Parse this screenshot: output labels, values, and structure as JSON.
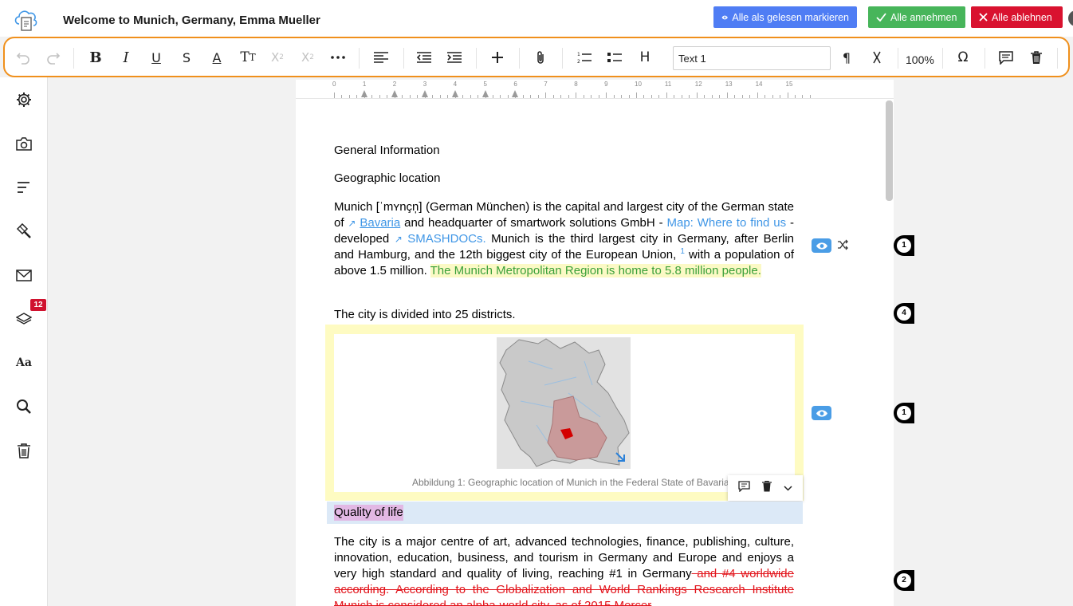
{
  "header": {
    "title": "Welcome to Munich, Germany, Emma Mueller",
    "mark_read_label": "Alle als gelesen markieren",
    "accept_all_label": "Alle annehmen",
    "reject_all_label": "Alle ablehnen",
    "colors": {
      "mark_read": "#4f7df4",
      "accept": "#47b55a",
      "reject": "#d9122f"
    }
  },
  "toolbar": {
    "paragraph_style": "Text 1",
    "zoom": "100%",
    "highlight_color": "#f0901c",
    "icons": [
      "undo-icon",
      "redo-icon",
      "bold-icon",
      "italic-icon",
      "underline-icon",
      "strikethrough-icon",
      "font-color-icon",
      "font-size-icon",
      "superscript-icon",
      "subscript-icon",
      "more-icon",
      "align-left-icon",
      "outdent-icon",
      "indent-icon",
      "insert-icon",
      "attachment-icon",
      "numbered-list-icon",
      "bullet-list-icon",
      "heading-icon",
      "pilcrow-icon",
      "clear-format-icon",
      "omega-icon",
      "comment-icon",
      "trash-icon"
    ]
  },
  "sidebar": {
    "icons": [
      "gear-icon",
      "camera-icon",
      "outline-icon",
      "paint-brush-icon",
      "mail-icon",
      "layers-icon",
      "typography-icon",
      "search-icon",
      "trash-icon"
    ],
    "layers_badge": "12",
    "typography_label": "Aa"
  },
  "ruler": {
    "numbers": [
      "0",
      "1",
      "2",
      "3",
      "4",
      "5",
      "6",
      "7",
      "8",
      "9",
      "10",
      "11",
      "12",
      "13",
      "14",
      "15"
    ]
  },
  "document": {
    "heading1": "General Information",
    "heading2": "Geographic location",
    "para1": {
      "t1": "Munich [ˈmʏnçn̩] (German München) is the capital and largest city of the German state of ",
      "link_bavaria": "Bavaria",
      "t2": " and headquarter of smartwork solutions GmbH - ",
      "link_map": "Map: Where to find us",
      "t3": " - developed ",
      "link_smashdocs": "SMASHDOCs.",
      "t4": " Munich is the third largest city in Germany, after Berlin and Hamburg, and the 12th biggest city of the European Union, ",
      "footnote": "1",
      "t5": " with a population of above 1.5 million. ",
      "inserted": "The Munich Metropolitan Region is home to 5.8 million people."
    },
    "para2": "The city is divided into 25 districts.",
    "figure_caption": "Abbildung 1: Geographic location of Munich in the Federal State of Bavaria",
    "heading3": "Quality of life",
    "para3": {
      "t1": "The city is a major centre of art, advanced technologies, finance, publishing, culture, innovation, education, business, and tourism in Germany and Europe and enjoys a very high standard and quality of living, reaching #1 in Germany",
      "deleted": " and #4 worldwide according. According to the Globalization and World Rankings Research Institute Munich is considered an alpha-world city, as of 2015 Mercer"
    }
  },
  "markers": {
    "counts": [
      "1",
      "4",
      "1",
      "2"
    ]
  }
}
